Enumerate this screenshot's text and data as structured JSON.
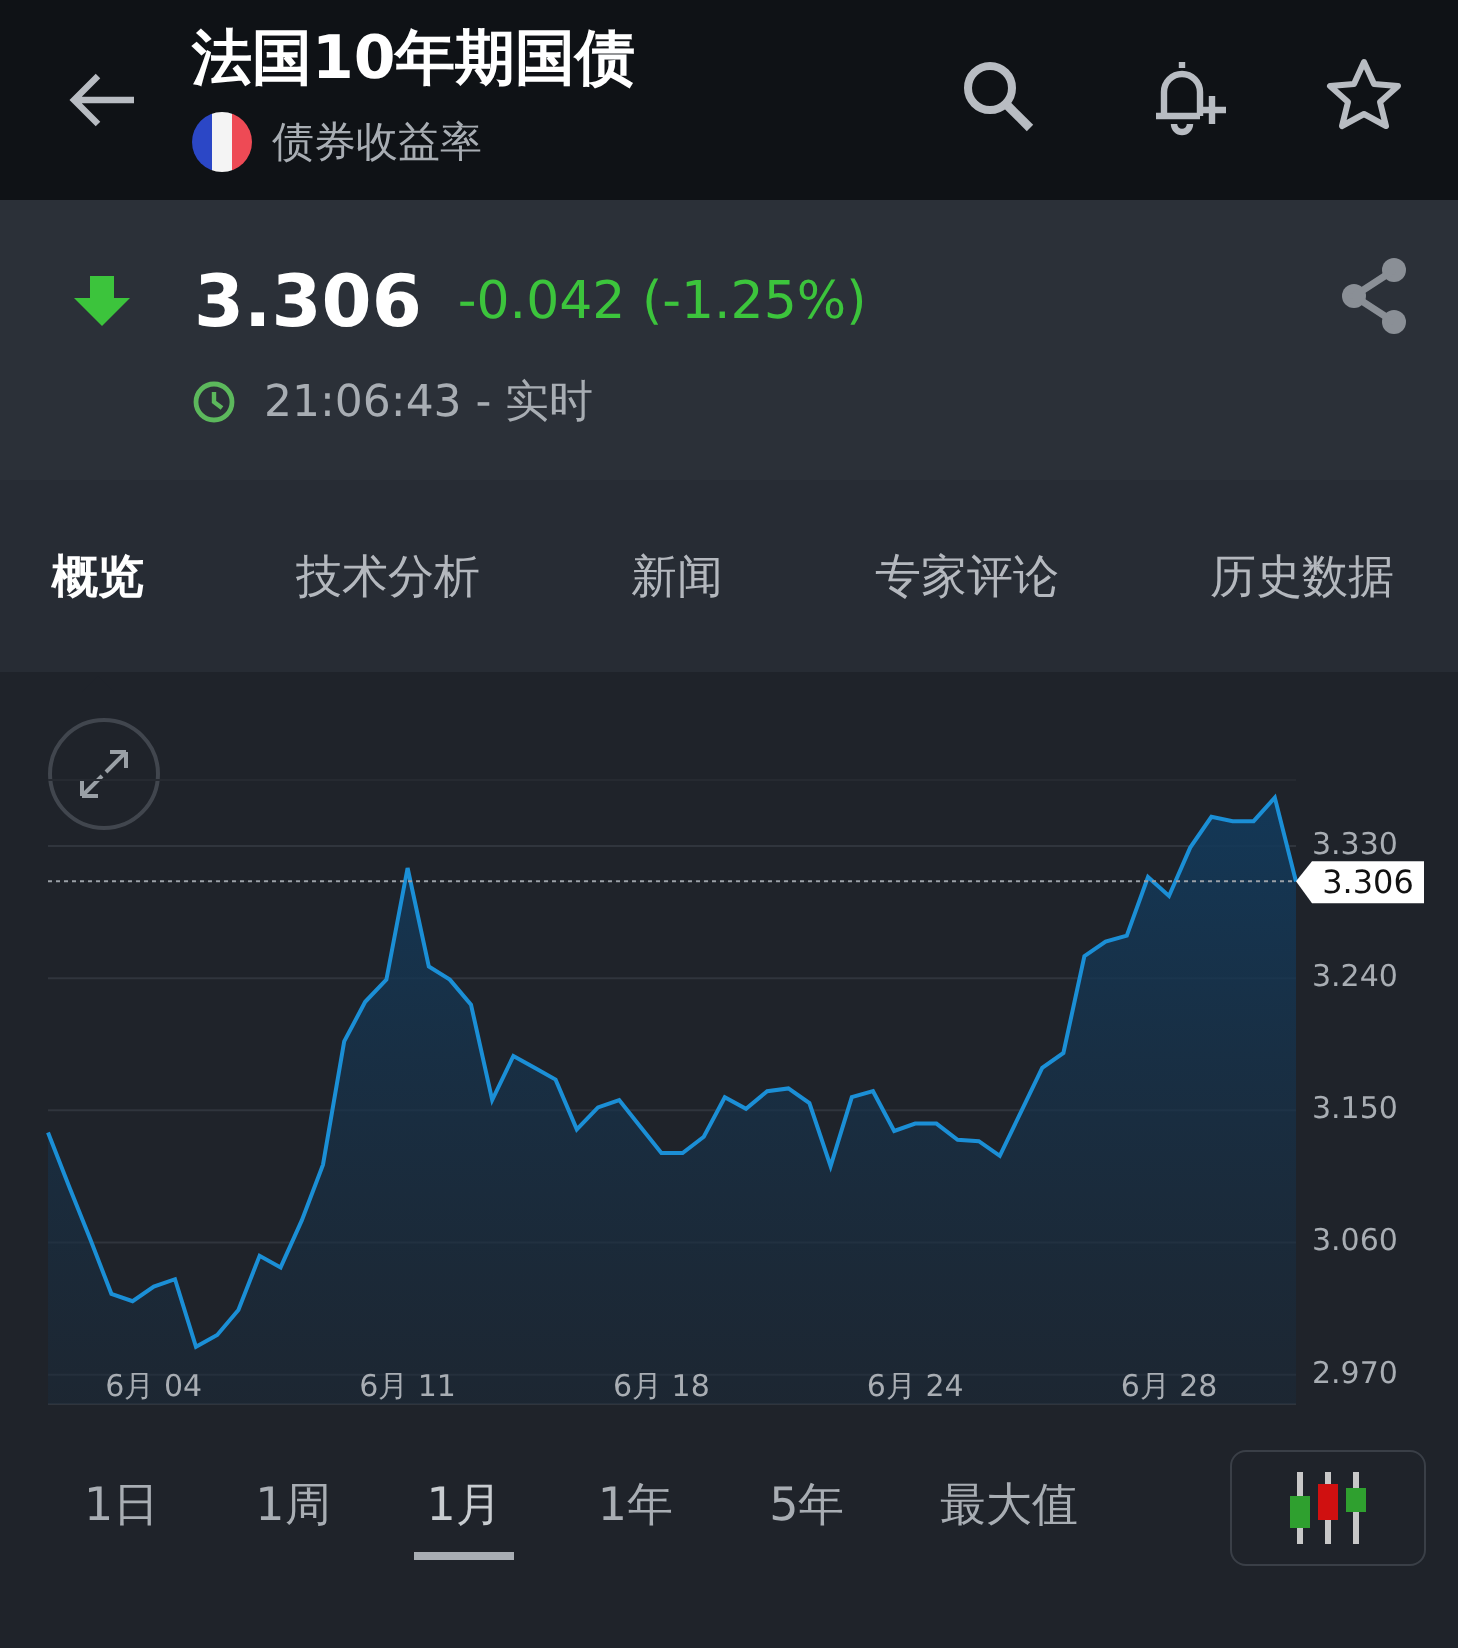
{
  "header": {
    "title": "法国10年期国债",
    "subtitle": "债券收益率"
  },
  "quote": {
    "price": "3.306",
    "change": "-0.042 (-1.25%)",
    "falling": true,
    "time": "21:06:43 - 实时"
  },
  "tabs": [
    {
      "label": "概览",
      "selected": true
    },
    {
      "label": "技术分析",
      "selected": false
    },
    {
      "label": "新闻",
      "selected": false
    },
    {
      "label": "专家评论",
      "selected": false
    },
    {
      "label": "历史数据",
      "selected": false
    }
  ],
  "chart": {
    "chart_data": {
      "type": "area",
      "categories": [
        null,
        null,
        null,
        null,
        null,
        "6月 04",
        null,
        null,
        null,
        null,
        null,
        null,
        null,
        null,
        null,
        null,
        null,
        "6月 11",
        null,
        null,
        null,
        null,
        null,
        null,
        null,
        null,
        null,
        null,
        null,
        "6月 18",
        null,
        null,
        null,
        null,
        null,
        null,
        null,
        null,
        null,
        null,
        null,
        "6月 24",
        null,
        null,
        null,
        null,
        null,
        null,
        null,
        null,
        null,
        null,
        null,
        "6月 28",
        null,
        null,
        null,
        null,
        null,
        null
      ],
      "series": [
        {
          "color": "#1b8fd6",
          "values": [
            3.135,
            3.098,
            3.062,
            3.025,
            3.02,
            3.03,
            3.035,
            2.989,
            2.997,
            3.014,
            3.051,
            3.043,
            3.075,
            3.113,
            3.197,
            3.224,
            3.239,
            3.315,
            3.248,
            3.239,
            3.222,
            3.157,
            3.187,
            3.179,
            3.171,
            3.137,
            3.152,
            3.157,
            3.139,
            3.121,
            3.121,
            3.132,
            3.159,
            3.151,
            3.163,
            3.165,
            3.155,
            3.112,
            3.159,
            3.163,
            3.136,
            3.141,
            3.141,
            3.13,
            3.129,
            3.119,
            3.149,
            3.179,
            3.189,
            3.255,
            3.265,
            3.269,
            3.309,
            3.296,
            3.329,
            3.35,
            3.347,
            3.347,
            3.363,
            3.306
          ]
        }
      ],
      "grid": true,
      "ylim": [
        2.95,
        3.375
      ],
      "yticks": [
        {
          "value": 2.97,
          "label": "2.970"
        },
        {
          "value": 3.06,
          "label": "3.060"
        },
        {
          "value": 3.15,
          "label": "3.150"
        },
        {
          "value": 3.24,
          "label": "3.240"
        },
        {
          "value": 3.33,
          "label": "3.330"
        }
      ],
      "ref_lines": [
        {
          "axis": "y",
          "value": 3.306,
          "label": "3.306"
        }
      ]
    }
  },
  "ranges": [
    {
      "label": "1日",
      "selected": false
    },
    {
      "label": "1周",
      "selected": false
    },
    {
      "label": "1月",
      "selected": true
    },
    {
      "label": "1年",
      "selected": false
    },
    {
      "label": "5年",
      "selected": false
    },
    {
      "label": "最大值",
      "selected": false
    }
  ]
}
